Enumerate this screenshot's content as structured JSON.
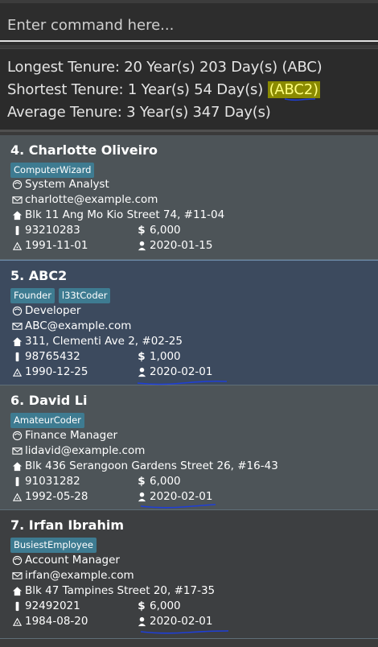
{
  "command": {
    "placeholder": "Enter command here..."
  },
  "result": {
    "longest_prefix": "Longest Tenure: 20 Year(s) 203 Day(s) (ABC)",
    "shortest_prefix": "Shortest Tenure: 1 Year(s) 54 Day(s) ",
    "shortest_highlight": "(ABC2)",
    "average": "Average Tenure: 3 Year(s) 347 Day(s)"
  },
  "persons": [
    {
      "index_name": "4.  Charlotte Oliveiro",
      "tags": [
        "ComputerWizard"
      ],
      "role": "System Analyst",
      "email": "charlotte@example.com",
      "address": "Blk 11 Ang Mo Kio Street 74, #11-04",
      "phone": "93210283",
      "salary": "6,000",
      "birthday": "1991-11-01",
      "join_date": "2020-01-15"
    },
    {
      "index_name": "5.  ABC2",
      "tags": [
        "Founder",
        "l33tCoder"
      ],
      "role": "Developer",
      "email": "ABC@example.com",
      "address": "311, Clementi Ave 2, #02-25",
      "phone": "98765432",
      "salary": "1,000",
      "birthday": "1990-12-25",
      "join_date": "2020-02-01"
    },
    {
      "index_name": "6.  David Li",
      "tags": [
        "AmateurCoder"
      ],
      "role": "Finance Manager",
      "email": "lidavid@example.com",
      "address": "Blk 436 Serangoon Gardens Street 26, #16-43",
      "phone": "91031282",
      "salary": "6,000",
      "birthday": "1992-05-28",
      "join_date": "2020-02-01"
    },
    {
      "index_name": "7.  Irfan Ibrahim",
      "tags": [
        "BusiestEmployee"
      ],
      "role": "Account Manager",
      "email": "irfan@example.com",
      "address": "Blk 47 Tampines Street 20, #17-35",
      "phone": "92492021",
      "salary": "6,000",
      "birthday": "1984-08-20",
      "join_date": "2020-02-01"
    }
  ],
  "icons": {
    "role": "person-head-icon",
    "email": "envelope-icon",
    "address": "house-icon",
    "phone": "phone-icon",
    "salary": "dollar-icon",
    "birthday": "cake-icon",
    "join_date": "employee-icon"
  },
  "salary_symbol": "$",
  "colors": {
    "tag": "#3e7b91",
    "highlight": "#8a8a00",
    "scribble": "#1f3fd6"
  }
}
